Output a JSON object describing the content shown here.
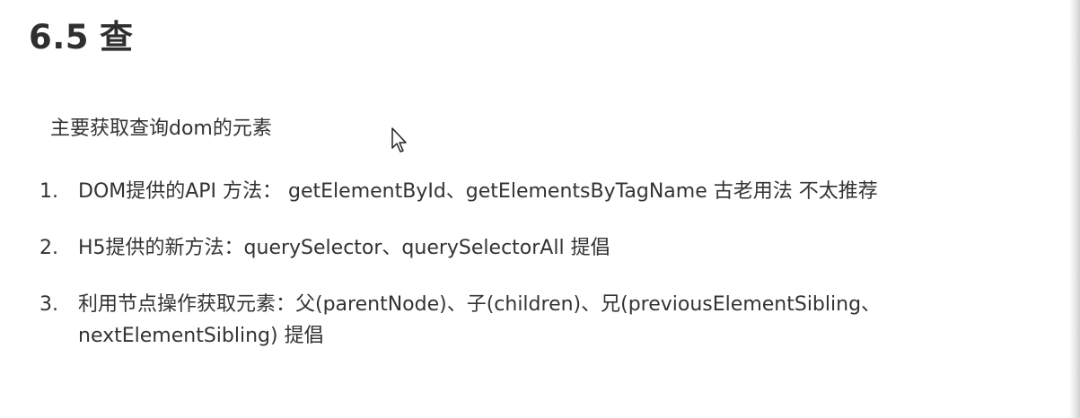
{
  "heading": {
    "number": "6.5",
    "title": "查"
  },
  "intro": "主要获取查询dom的元素",
  "list": [
    {
      "marker": "1.",
      "lines": [
        "DOM提供的API 方法：  getElementById、getElementsByTagName  古老用法 不太推荐"
      ]
    },
    {
      "marker": "2.",
      "lines": [
        "H5提供的新方法：querySelector、querySelectorAll   提倡"
      ]
    },
    {
      "marker": "3.",
      "lines": [
        "利用节点操作获取元素：父(parentNode)、子(children)、兄(previousElementSibling、",
        "nextElementSibling) 提倡"
      ]
    }
  ],
  "cursor_icon": "mouse-pointer-icon"
}
